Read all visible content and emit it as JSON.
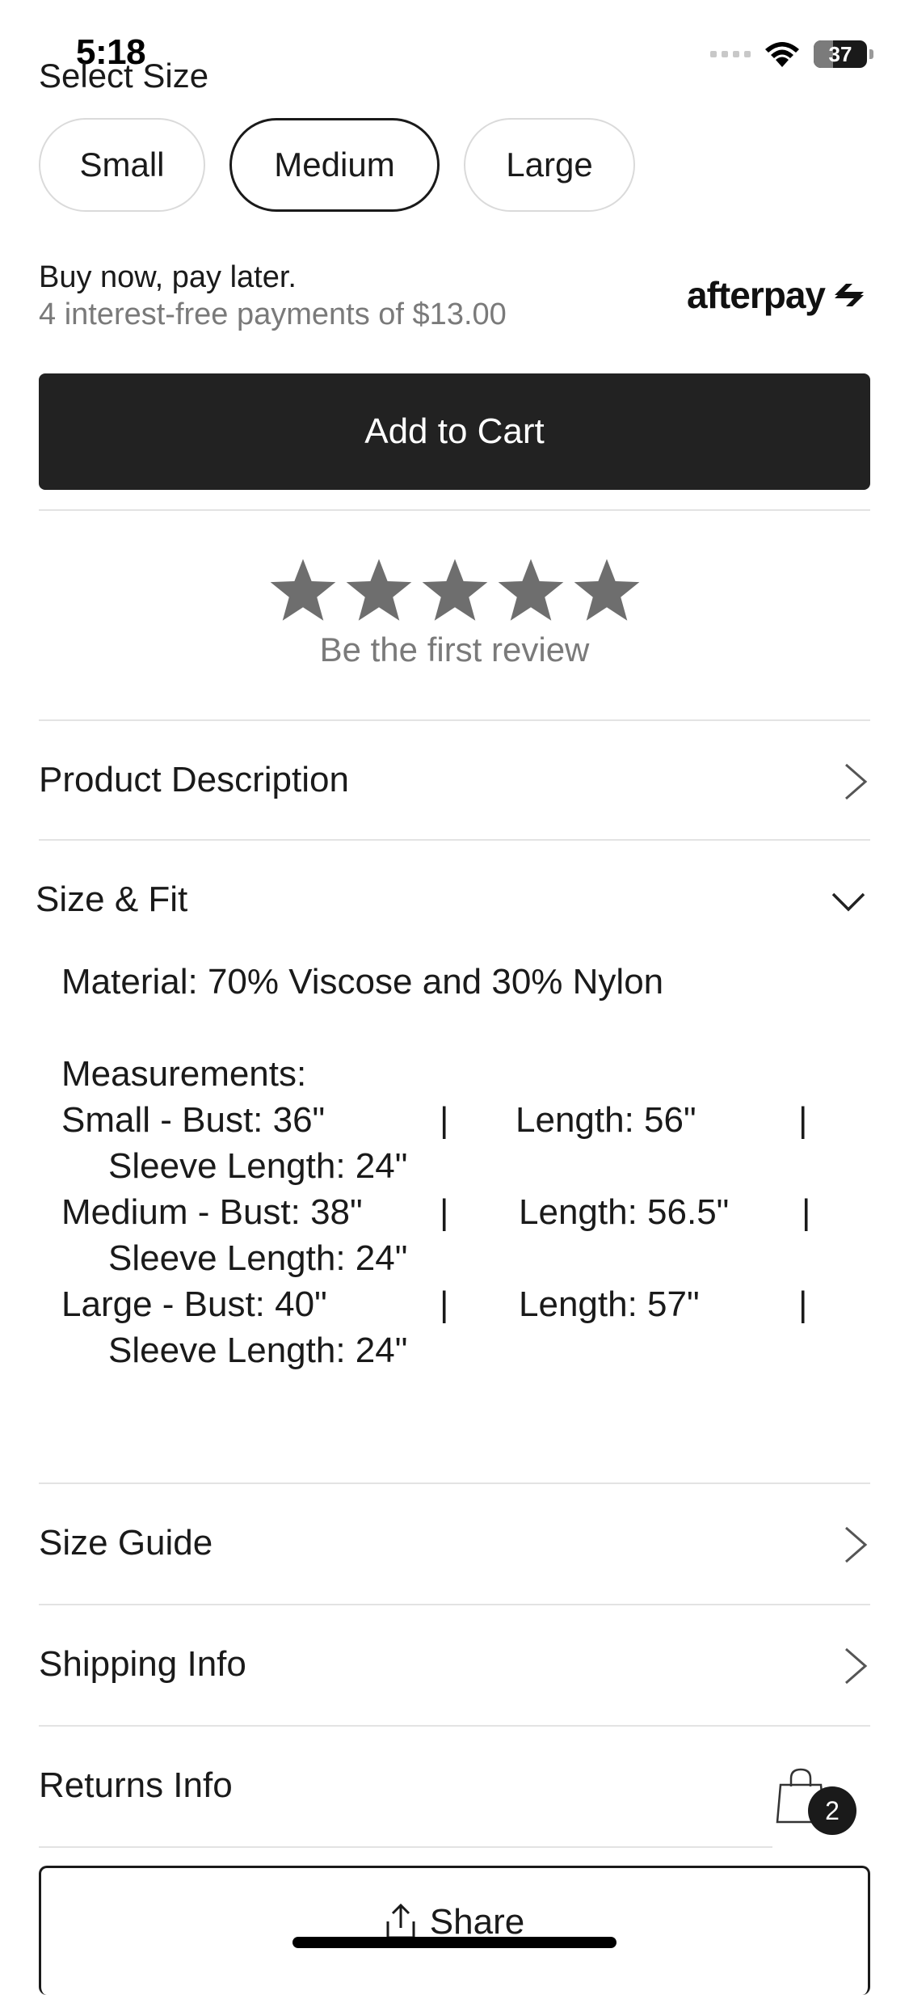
{
  "status_bar": {
    "time": "5:18",
    "battery": "37",
    "battery_fraction": 0.37
  },
  "size_selector": {
    "title": "Select Size",
    "options": [
      "Small",
      "Medium",
      "Large"
    ],
    "selected": "Medium"
  },
  "bnpl": {
    "title": "Buy now, pay later.",
    "subtitle": "4 interest-free payments of $13.00",
    "provider_logo_text": "afterpay"
  },
  "cart_button": {
    "label": "Add to Cart"
  },
  "reviews": {
    "stars_total": 5,
    "prompt": "Be the first review"
  },
  "sections": {
    "product_description": "Product Description",
    "size_fit": "Size & Fit",
    "size_guide": "Size Guide",
    "shipping_info": "Shipping Info",
    "returns_info": "Returns Info"
  },
  "size_fit": {
    "material": "Material: 70% Viscose and 30% Nylon",
    "measurements_title": "Measurements:",
    "rows": [
      {
        "size_bust": "Small - Bust: 36\"",
        "sep1": "|",
        "length": "Length: 56\"",
        "sep2": "|",
        "sleeve": "Sleeve Length: 24\""
      },
      {
        "size_bust": "Medium - Bust: 38\"",
        "sep1": "|",
        "length": "Length: 56.5\"",
        "sep2": "|",
        "sleeve": "Sleeve Length: 24\""
      },
      {
        "size_bust": "Large - Bust: 40\"",
        "sep1": "|",
        "length": "Length: 57\"",
        "sep2": "|",
        "sleeve": "Sleeve Length: 24\""
      }
    ]
  },
  "cart": {
    "count": "2"
  },
  "share": {
    "label": "Share"
  },
  "icons": {
    "chevron": "chevron-right-icon",
    "chevron_open": "chevron-down-icon",
    "bag": "shopping-bag-icon",
    "share": "share-icon",
    "star": "star-icon"
  }
}
